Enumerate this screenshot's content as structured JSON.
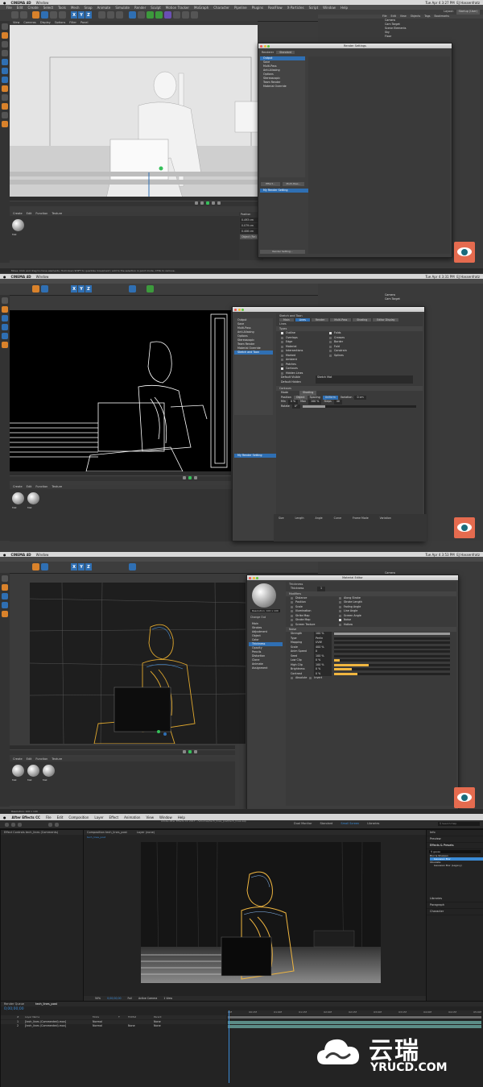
{
  "panels": [
    {
      "app_title": "CINEMA 4D",
      "window_menu": "Window",
      "clock": "Tue Apr 4  3:27 PM",
      "user": "EJ Hassenfratz",
      "menus": [
        "File",
        "Edit",
        "Create",
        "Select",
        "Tools",
        "Mesh",
        "Snap",
        "Animate",
        "Simulate",
        "Render",
        "Sculpt",
        "Motion Tracker",
        "MoGraph",
        "Character",
        "Pipeline",
        "Plugins",
        "RealFlow",
        "X-Particles",
        "Script",
        "Window",
        "Help"
      ],
      "viewport_menu": [
        "View",
        "Cameras",
        "Display",
        "Options",
        "Filter",
        "Panel"
      ],
      "dialog_title": "Render Settings",
      "dialog_renderer_label": "Renderer",
      "dialog_renderer_value": "Standard",
      "dialog_items": [
        "Output",
        "Save",
        "Multi-Pass",
        "Anti-Aliasing",
        "Options",
        "Stereoscopic",
        "Team Render",
        "Material Override"
      ],
      "dialog_effect_button": "Effect...",
      "dialog_multipass_button": "Multi-Pass...",
      "dialog_preset": "My Render Setting",
      "dialog_preset_footer": "Render Setting...",
      "material_menu": [
        "Create",
        "Edit",
        "Function",
        "Texture"
      ],
      "materials": [
        "Mat"
      ],
      "coords_header": "Position",
      "coords": [
        "0.493 cm",
        "0.079 cm",
        "0.406 cm"
      ],
      "apply_button": "Object (Rel)",
      "status": "Move: Click and drag to move elements. Hold down SHIFT to quantize movement / add to the selection in point mode, CTRL to remove.",
      "object_manager_menu": [
        "File",
        "Edit",
        "View",
        "Objects",
        "Tags",
        "Bookmarks"
      ],
      "objects": [
        "Camera",
        "Cam Target",
        "Scene Elements",
        "Sky",
        "Floor"
      ],
      "layout_label": "Layout:",
      "layout_value": "Startup (User)"
    },
    {
      "app_title": "CINEMA 4D",
      "window_menu": "Window",
      "clock": "Tue Apr 4  3:31 PM",
      "user": "EJ Hassenfratz",
      "dialog_title": "Sketch and Toon",
      "dialog_tabs": [
        "Main",
        "Lines",
        "Render",
        "Multi-Pass",
        "Shading",
        "Editor Display"
      ],
      "lines_section": "Lines",
      "types_section": "Types",
      "types_left": [
        "Outline",
        "Overlaps",
        "Edge",
        "Material",
        "Intersections",
        "Marked",
        "Ambient",
        "Patches",
        "Contours",
        "Hidden Lines"
      ],
      "types_right": [
        "Folds",
        "Creases",
        "Border",
        "Fold",
        "Constrain",
        "Splines"
      ],
      "default_visible_label": "Default Visible",
      "default_visible_value": "Sketch Mat",
      "default_hidden_label": "Default Hidden",
      "contours_section": "Contours",
      "mode_label": "Mode",
      "mode_value": "Shading",
      "position_label": "Position",
      "position_value": "Object",
      "spacing_label": "Spacing",
      "spacing_value": "Uniform",
      "variation_label": "Variation",
      "variation_value": "0 cm",
      "min_label": "Min",
      "min_value": "0 %",
      "max_label": "Max",
      "max_value": "100 %",
      "steps_label": "Steps",
      "steps_value": "40",
      "rotate_label": "Rotate",
      "rotate_value": "0°",
      "renderer_list": [
        "Output",
        "Save",
        "Multi-Pass",
        "Anti-Aliasing",
        "Options",
        "Stereoscopic",
        "Team Render",
        "Material Override",
        "Sketch and Toon"
      ],
      "dialog_preset": "My Render Setting",
      "coords": [
        "Size",
        "Length",
        "Angle",
        "Curve",
        "Frame Mode",
        "Variation",
        "Variation",
        "Variation"
      ],
      "materials": [
        "Mat",
        "Mat"
      ]
    },
    {
      "app_title": "CINEMA 4D",
      "window_menu": "Window",
      "clock": "Tue Apr 4  3:53 PM",
      "user": "EJ Hassenfratz",
      "dialog_title": "Material Editor",
      "preview_label": "Resolution: 100 x 100",
      "material_name": "Change Out",
      "material_channels": [
        "Main",
        "Strokes",
        "Adjustment",
        "Object",
        "Color",
        "Thickness",
        "Opacity",
        "Pencils",
        "Distortion",
        "Clone",
        "Animate",
        "Assignment"
      ],
      "thickness_header": "Thickness",
      "thickness_value": "1",
      "modifiers_header": "Modifiers",
      "modifiers_left": [
        "Distance",
        "Position",
        "Scale",
        "Illumination",
        "Strike Map",
        "Stroke Map",
        "Screen Texture"
      ],
      "modifiers_right": [
        "Along Stroke",
        "Stroke Length",
        "Fading Angle",
        "Line Angle",
        "Screen Angle",
        "Noise",
        "Hollow"
      ],
      "noise_header": "Noise",
      "noise_rows": [
        {
          "label": "Strength",
          "value": "100 %",
          "fill": 1.0
        },
        {
          "label": "Type",
          "value": "Perlin",
          "fill": 0
        },
        {
          "label": "Mapping",
          "value": "UVW",
          "fill": 0
        },
        {
          "label": "Scale",
          "value": "400 %",
          "fill": 0
        },
        {
          "label": "Anim Speed",
          "value": "0",
          "fill": 0
        },
        {
          "label": "Seed",
          "value": "100 %",
          "fill": 0
        },
        {
          "label": "Low Clip",
          "value": "0 %",
          "fill": 0.05
        },
        {
          "label": "High Clip",
          "value": "100 %",
          "fill": 0.3
        },
        {
          "label": "Brightness",
          "value": "0 %",
          "fill": 0.15
        },
        {
          "label": "Contrast",
          "value": "0 %",
          "fill": 0.2
        }
      ],
      "absolute_label": "Absolute",
      "invert_label": "Invert",
      "status": "Resolution: 100 x 100",
      "materials": [
        "Mat",
        "Mat",
        "Mat"
      ]
    },
    {
      "app_title": "After Effects CC",
      "menus": [
        "File",
        "Edit",
        "Composition",
        "Layer",
        "Effect",
        "Animation",
        "View",
        "Window",
        "Help"
      ],
      "window_title": "Adobe After Effects CC 2017 - /Volumes/tech_lines_post/tech_lines.aep",
      "workspaces": [
        "Dual Monitor",
        "Standard",
        "Small Screen",
        "Libraries"
      ],
      "active_workspace": "Small Screen",
      "search_placeholder": "Search Help",
      "project_tab": "Effect Controls tech_lines (Comments)",
      "composition_tab": "Composition tech_lines_post",
      "layer_tab": "Layer (none)",
      "comp_name": "tech_lines_post",
      "footer_zoom": "50%",
      "footer_time": "0;00;00;00",
      "footer_quality": "Full",
      "footer_camera": "Active Camera",
      "footer_view": "1 View",
      "right_items": [
        "Info",
        "Preview",
        "Effects & Presets",
        "Libraries",
        "Paragraph",
        "Character"
      ],
      "effects_search": "gauss",
      "effects_tree": [
        "Blur & Sharpen",
        "Gaussian Blur",
        "Obsolete",
        "Gaussian Blur (Legacy)"
      ],
      "timeline_tabs": [
        "Render Queue",
        "tech_lines_post"
      ],
      "timecode": "0;00;00;00",
      "layer_columns": [
        "#",
        "Layer Name",
        "Mode",
        "T",
        "TrkMat",
        "Parent"
      ],
      "layers": [
        {
          "num": "1",
          "name": "[tech_lines (Commented).mov]",
          "mode": "Normal",
          "trk": "",
          "parent": "None"
        },
        {
          "num": "2",
          "name": "[tech_lines (Commented).mov]",
          "mode": "Normal",
          "trk": "None",
          "parent": "None"
        }
      ],
      "ruler_ticks": [
        "00f",
        "00:15f",
        "01:00f",
        "01:15f",
        "02:00f",
        "02:15f",
        "03:00f",
        "03:15f",
        "04:00f",
        "04:15f",
        "05:00f"
      ]
    }
  ],
  "watermark": {
    "cn": "云瑞",
    "en": "YRUCD.COM"
  },
  "colors": {
    "accent": "#2f6fb3",
    "c4d_orange": "#d9822b",
    "ae_blue": "#3b8bd6",
    "logo_bg": "#e56b4f"
  }
}
